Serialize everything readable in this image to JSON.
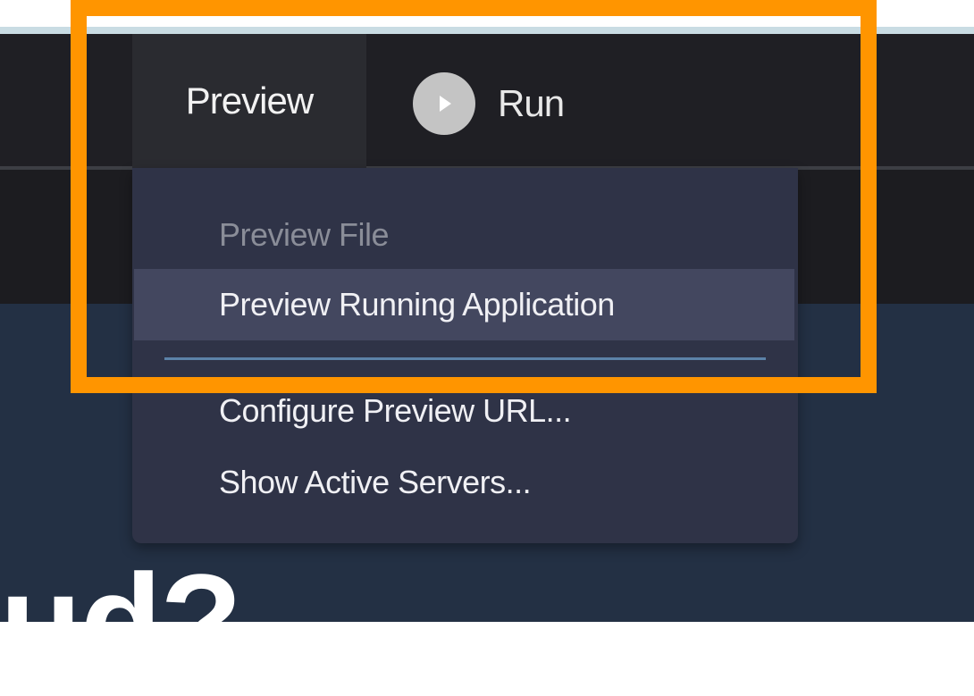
{
  "toolbar": {
    "preview_tab_label": "Preview",
    "run_label": "Run"
  },
  "preview_menu": {
    "items": [
      {
        "label": "Preview File",
        "state": "disabled"
      },
      {
        "label": "Preview Running Application",
        "state": "highlighted"
      },
      {
        "label": "Configure Preview URL...",
        "state": "normal"
      },
      {
        "label": "Show Active Servers...",
        "state": "normal"
      }
    ]
  },
  "background_heading_fragment": "ud?",
  "colors": {
    "toolbar_bg": "#1f1f24",
    "menu_bg": "#2f3347",
    "menu_highlight": "#43475f",
    "separator": "#5c82a8",
    "annotation_outline": "#ff9500",
    "content_bg": "#233044"
  }
}
